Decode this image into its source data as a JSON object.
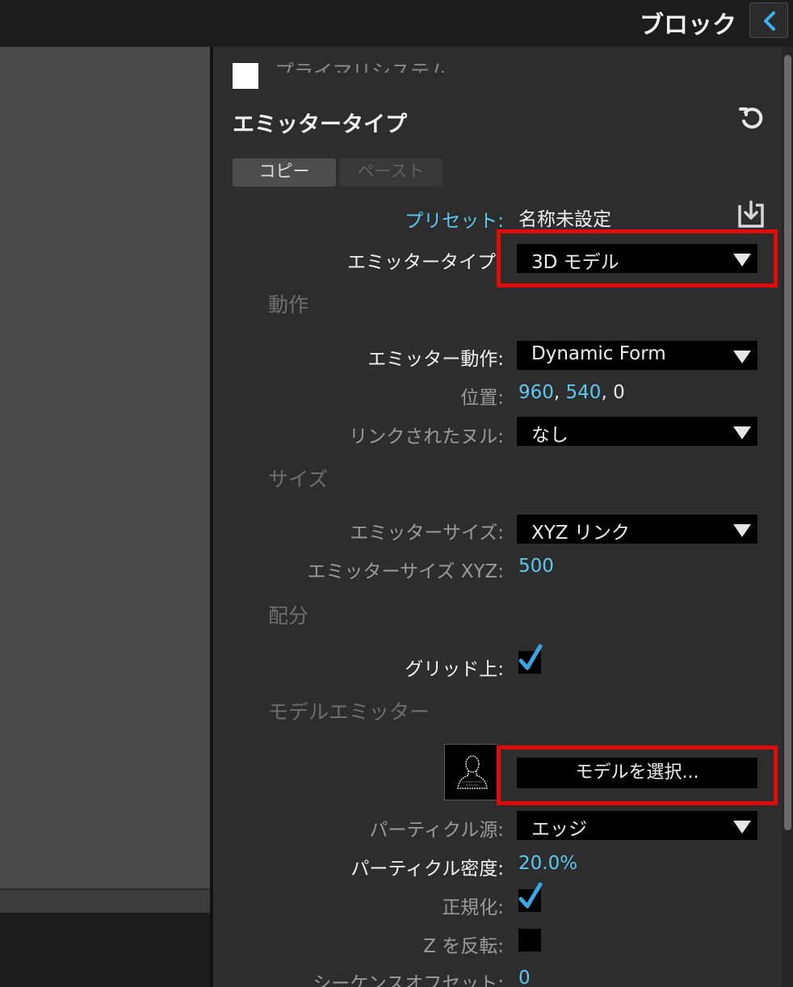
{
  "header": {
    "title": "ブロック"
  },
  "panel": {
    "cut_title": "プライマリシステム",
    "section_title": "エミッタータイプ",
    "buttons": {
      "copy": "コピー",
      "paste": "ペースト"
    },
    "preset": {
      "label": "プリセット:",
      "value": "名称未設定"
    },
    "emitter_type": {
      "label": "エミッタータイプ",
      "value": "3D モデル"
    },
    "groups": {
      "motion": "動作",
      "size": "サイズ",
      "distribution": "配分",
      "model_emitter": "モデルエミッター"
    },
    "emitter_behavior": {
      "label": "エミッター動作:",
      "value": "Dynamic Form"
    },
    "position": {
      "label": "位置:",
      "x": "960",
      "y": "540",
      "z": "0",
      "sep": ","
    },
    "linked_null": {
      "label": "リンクされたヌル:",
      "value": "なし"
    },
    "emitter_size": {
      "label": "エミッターサイズ:",
      "value": "XYZ リンク"
    },
    "emitter_size_xyz": {
      "label": "エミッターサイズ XYZ:",
      "value": "500"
    },
    "on_grid": {
      "label": "グリッド上:",
      "checked": true
    },
    "select_model": {
      "label": "モデルを選択..."
    },
    "particle_source": {
      "label": "パーティクル源:",
      "value": "エッジ"
    },
    "particle_density": {
      "label": "パーティクル密度:",
      "value": "20.0%"
    },
    "normalize": {
      "label": "正規化:",
      "checked": true
    },
    "flip_z": {
      "label": "Z を反転:",
      "checked": false
    },
    "sequence_offset": {
      "label": "シーケンスオフセット:",
      "value": "0"
    }
  },
  "colors": {
    "accent_value": "#5bc8f0",
    "highlight": "#e00b0b",
    "panel_bg": "#2d2d2d"
  },
  "icons": [
    "chevron-left-icon",
    "reset-icon",
    "save-preset-icon",
    "checkmark-icon",
    "model-thumbnail-icon",
    "dropdown-arrow-icon"
  ]
}
